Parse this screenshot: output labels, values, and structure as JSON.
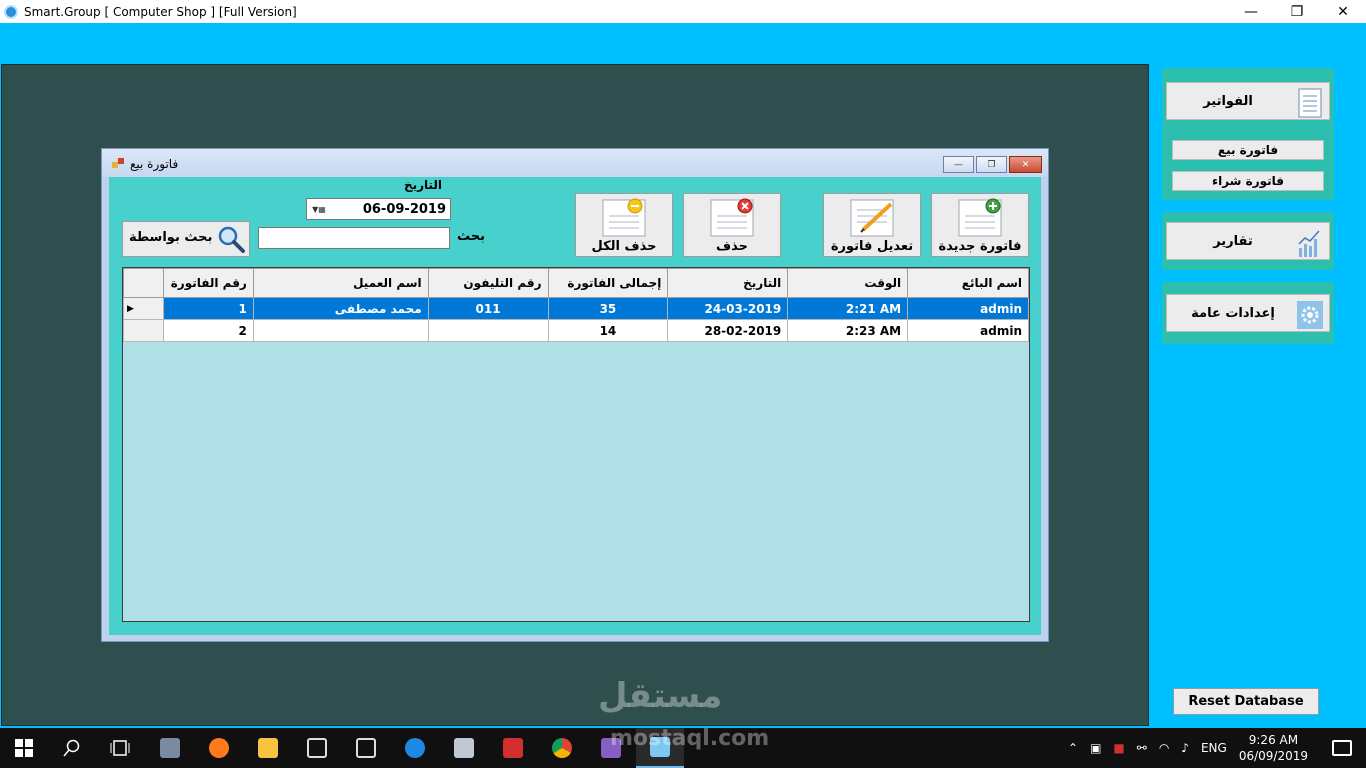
{
  "window": {
    "title": "Smart.Group [ Computer Shop ] [Full Version]",
    "minimize": "—",
    "restore": "❐",
    "close": "✕"
  },
  "sidebar": {
    "invoices": "الفواتير",
    "sales_invoice": "فاتورة بيع",
    "purchase_invoice": "فاتورة شراء",
    "reports": "تقارير",
    "settings": "إعدادات عامة",
    "reset_db": "Reset Database"
  },
  "child": {
    "title": "فاتورة بيع",
    "date_label": "التاريخ",
    "date_value": "06-09-2019",
    "search_label": "بحث",
    "search_value": "",
    "search_by": "بحث بواسطة",
    "actions": {
      "new_invoice": "فاتورة جديدة",
      "edit_invoice": "تعديل فاتورة",
      "delete": "حذف",
      "delete_all": "حذف الكل"
    }
  },
  "grid": {
    "columns": [
      "رقم الفاتورة",
      "اسم العميل",
      "رقم التليفون",
      "إجمالى الفاتورة",
      "التاريخ",
      "الوقت",
      "اسم البائع"
    ],
    "rows": [
      {
        "invoice_no": "1",
        "customer": "محمد مصطفى",
        "phone": "011",
        "total": "35",
        "date": "24-03-2019",
        "time": "2:21 AM",
        "seller": "admin"
      },
      {
        "invoice_no": "2",
        "customer": "",
        "phone": "",
        "total": "14",
        "date": "28-02-2019",
        "time": "2:23 AM",
        "seller": "admin"
      }
    ],
    "selected_row_marker": "▶"
  },
  "taskbar": {
    "lang": "ENG",
    "time": "9:26 AM",
    "date": "06/09/2019"
  },
  "watermark": {
    "arabic": "مستقل",
    "latin": "mostaql.com"
  },
  "colors": {
    "accent": "#00bfff",
    "workspace": "#2f4f4f",
    "panel": "#48d1cc",
    "grid_bg": "#b0e0e6",
    "selection": "#0078d7"
  }
}
